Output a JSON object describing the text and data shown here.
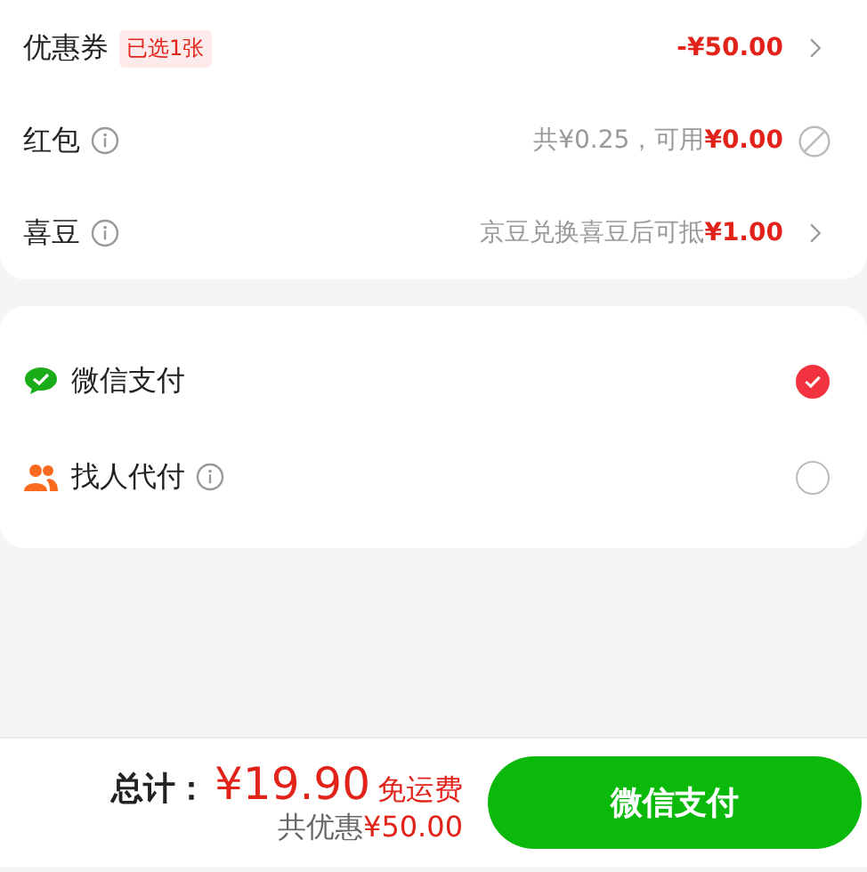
{
  "discounts": [
    {
      "kind": "chevron",
      "label": "优惠券",
      "info": false,
      "badge": "已选1张",
      "amount": "-¥50.00"
    },
    {
      "kind": "disabled",
      "label": "红包",
      "info": true,
      "note": "共¥0.25，可用",
      "amount": "¥0.00"
    },
    {
      "kind": "chevron",
      "label": "喜豆",
      "info": true,
      "note": "京豆兑换喜豆后可抵",
      "amount": "¥1.00"
    }
  ],
  "payments": [
    {
      "kind": "wechat",
      "label": "微信支付",
      "info": false,
      "selected": true
    },
    {
      "kind": "friend",
      "label": "找人代付",
      "info": true,
      "selected": false
    }
  ],
  "footer": {
    "total_label": "总计：",
    "total": "¥19.90",
    "shipping": "免运费",
    "savings_label": "共优惠",
    "savings": "¥50.00",
    "button": "微信支付"
  }
}
